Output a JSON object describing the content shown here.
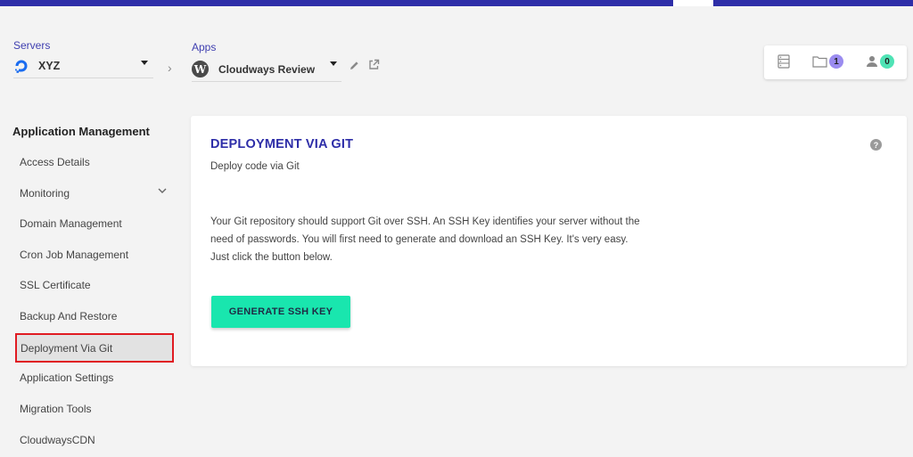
{
  "header": {
    "servers_label": "Servers",
    "server_value": "XYZ",
    "apps_label": "Apps",
    "app_value": "Cloudways Review"
  },
  "widget": {
    "projects_count": "1",
    "team_count": "0"
  },
  "sidebar": {
    "title": "Application Management",
    "items": [
      {
        "label": "Access Details"
      },
      {
        "label": "Monitoring"
      },
      {
        "label": "Domain Management"
      },
      {
        "label": "Cron Job Management"
      },
      {
        "label": "SSL Certificate"
      },
      {
        "label": "Backup And Restore"
      },
      {
        "label": "Deployment Via Git"
      },
      {
        "label": "Application Settings"
      },
      {
        "label": "Migration Tools"
      },
      {
        "label": "CloudwaysCDN"
      }
    ],
    "active_index": 6
  },
  "main": {
    "title": "DEPLOYMENT VIA GIT",
    "subtitle": "Deploy code via Git",
    "description_lines": [
      "Your Git repository should support Git over SSH. An SSH Key identifies your server without the",
      "need of passwords. You will first need to generate and download an SSH Key. It's very easy.",
      "Just click the button below."
    ],
    "button_label": "GENERATE SSH KEY",
    "help_glyph": "?"
  },
  "colors": {
    "topbar": "#2e2ea8",
    "accent_text": "#2e2ea8",
    "button": "#19e6ae",
    "active_outline": "#e01b22",
    "badge_projects": "#9b8cf0",
    "badge_team": "#4fe3b5"
  },
  "icons": {
    "server_provider": "digitalocean-icon",
    "app_platform": "wordpress-icon",
    "edit": "pencil-icon",
    "external": "external-link-icon",
    "servers_widget": "server-list-icon",
    "projects_widget": "folder-icon",
    "team_widget": "user-icon"
  }
}
